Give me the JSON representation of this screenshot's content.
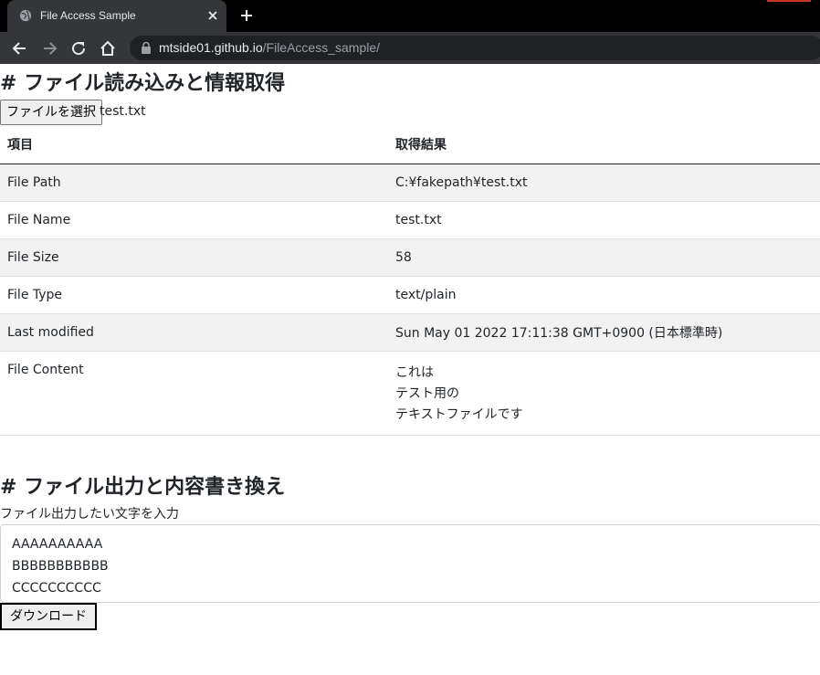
{
  "browser": {
    "tab_title": "File Access Sample",
    "url_host": "mtside01.github.io",
    "url_path": "/FileAccess_sample/"
  },
  "read_section": {
    "heading": "# ファイル読み込みと情報取得",
    "file_button_label": "ファイルを選択",
    "selected_file": "test.txt",
    "table": {
      "headers": [
        "項目",
        "取得結果"
      ],
      "rows": [
        {
          "item": "File Path",
          "value": "C:¥fakepath¥test.txt"
        },
        {
          "item": "File Name",
          "value": "test.txt"
        },
        {
          "item": "File Size",
          "value": "58"
        },
        {
          "item": "File Type",
          "value": "text/plain"
        },
        {
          "item": "Last modified",
          "value": "Sun May 01 2022 17:11:38 GMT+0900 (日本標準時)"
        }
      ],
      "content_row": {
        "item": "File Content",
        "lines": [
          "これは",
          "テスト用の",
          "テキストファイルです"
        ]
      }
    }
  },
  "write_section": {
    "heading": "# ファイル出力と内容書き換え",
    "input_label": "ファイル出力したい文字を入力",
    "textarea_lines": [
      "AAAAAAAAAA",
      "BBBBBBBBBBB",
      "CCCCCCCCCC"
    ],
    "download_button_label": "ダウンロード"
  },
  "colors": {
    "tabstrip": "#000000",
    "toolbar": "#35363a",
    "omnibox": "#202124",
    "stripe": "#f2f2f2"
  }
}
